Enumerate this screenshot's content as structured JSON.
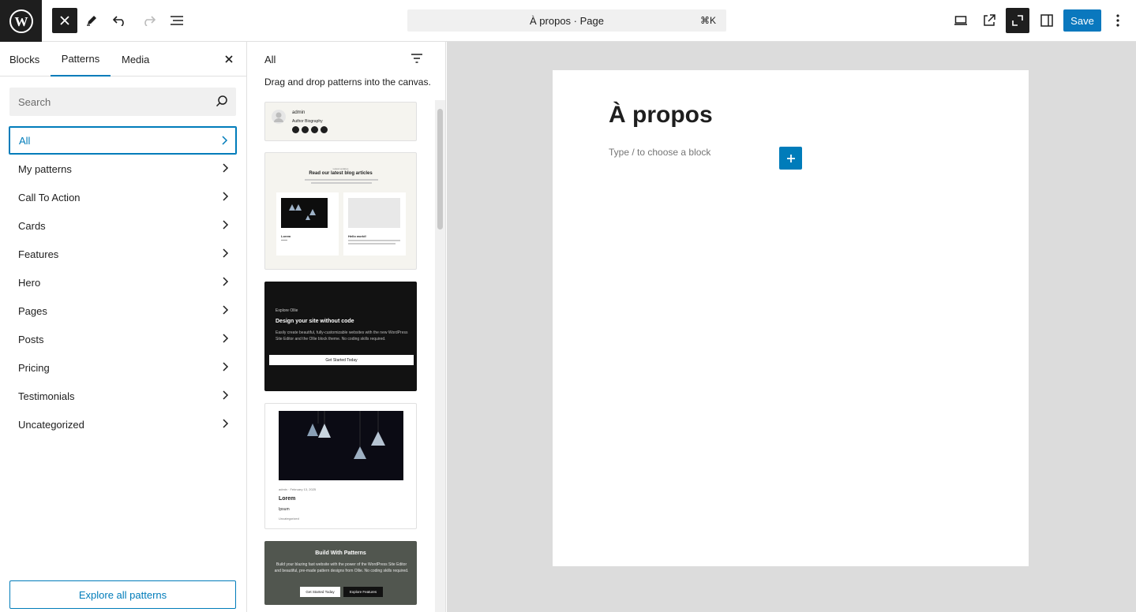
{
  "toolbar": {
    "doc_title": "À propos · Page",
    "shortcut": "⌘K",
    "save_label": "Save"
  },
  "sidebar": {
    "tabs": [
      "Blocks",
      "Patterns",
      "Media"
    ],
    "active_tab": "Patterns",
    "search_placeholder": "Search",
    "categories": [
      "All",
      "My patterns",
      "Call To Action",
      "Cards",
      "Features",
      "Hero",
      "Pages",
      "Posts",
      "Pricing",
      "Testimonials",
      "Uncategorized"
    ],
    "selected_category": "All",
    "explore_label": "Explore all patterns"
  },
  "patterns_panel": {
    "heading": "All",
    "hint": "Drag and drop patterns into the canvas.",
    "cards": {
      "bio": {
        "name": "admin",
        "sub": "Author Biography"
      },
      "blog": {
        "eyebrow": "Latest updates",
        "title": "Read our latest blog articles",
        "post1": "Lorem",
        "post2": "Hello world!"
      },
      "cta": {
        "eyebrow": "Explore Ollie",
        "title": "Design your site without code",
        "body": "Easily create beautiful, fully-customizable websites with the new WordPress Site Editor and the Ollie block theme. No coding skills required.",
        "button": "Get Started Today"
      },
      "post": {
        "meta": "admin · February 13, 2025",
        "title": "Lorem",
        "excerpt": "Ipsum",
        "category": "Uncategorized"
      },
      "hero": {
        "title": "Build With Patterns",
        "body": "Build your blazing fast website with the power of the WordPress Site Editor and beautiful, pre-made pattern designs from Ollie. No coding skills required.",
        "btn1": "Get Started Today",
        "btn2": "Explore Features"
      }
    }
  },
  "canvas": {
    "page_title": "À propos",
    "block_placeholder": "Type / to choose a block"
  },
  "colors": {
    "accent": "#007cba",
    "dark": "#1e1e1e",
    "canvas_bg": "#dcdcdc"
  }
}
